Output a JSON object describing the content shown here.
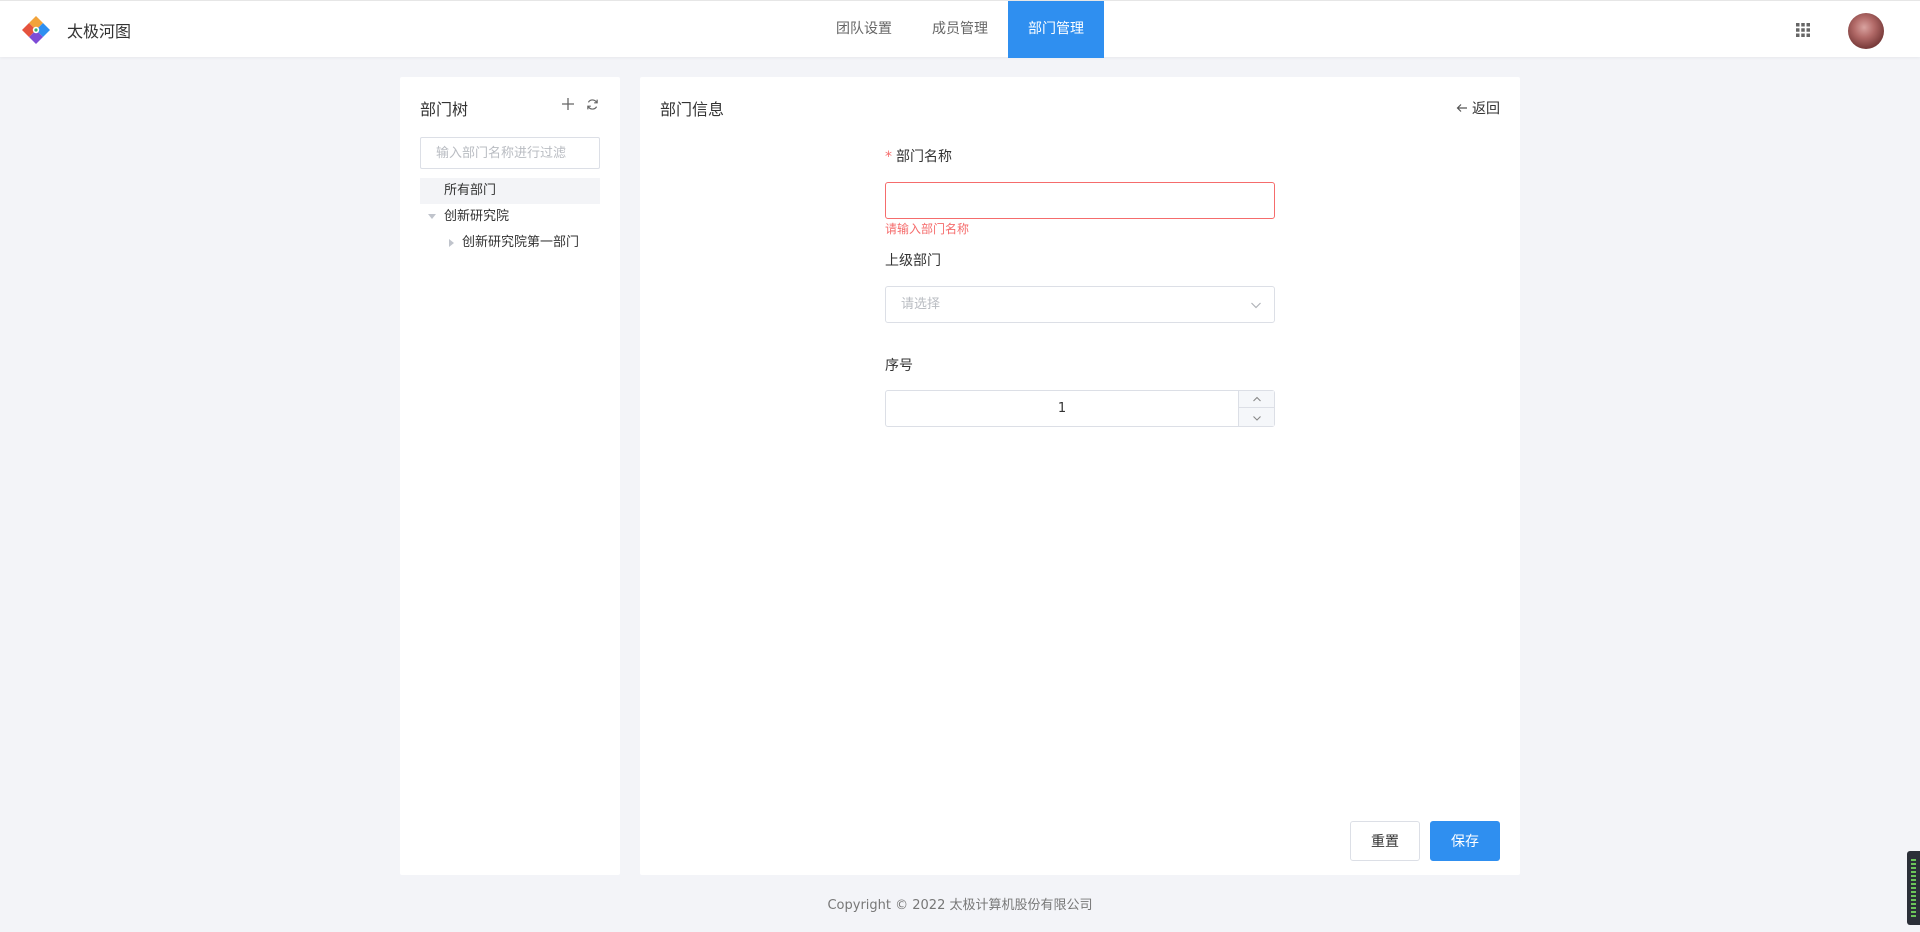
{
  "header": {
    "app_name": "太极河图",
    "nav": [
      {
        "label": "团队设置",
        "active": false
      },
      {
        "label": "成员管理",
        "active": false
      },
      {
        "label": "部门管理",
        "active": true
      }
    ],
    "accent_color": "#2f8ff0"
  },
  "tree_panel": {
    "title": "部门树",
    "filter_placeholder": "输入部门名称进行过滤",
    "nodes": [
      {
        "label": "所有部门",
        "level": 0,
        "selected": true
      },
      {
        "label": "创新研究院",
        "level": 1,
        "expanded": true
      },
      {
        "label": "创新研究院第一部门",
        "level": 2,
        "expanded": false
      }
    ]
  },
  "form_panel": {
    "title": "部门信息",
    "back_label": "返回",
    "fields": {
      "name": {
        "label": "部门名称",
        "required": true,
        "value": "",
        "error": "请输入部门名称"
      },
      "parent": {
        "label": "上级部门",
        "placeholder": "请选择"
      },
      "order": {
        "label": "序号",
        "value": "1"
      }
    },
    "buttons": {
      "reset": "重置",
      "save": "保存"
    }
  },
  "footer": {
    "copyright": "Copyright © 2022 太极计算机股份有限公司"
  },
  "colors": {
    "error": "#f56c6c",
    "primary": "#2f8ff0"
  }
}
